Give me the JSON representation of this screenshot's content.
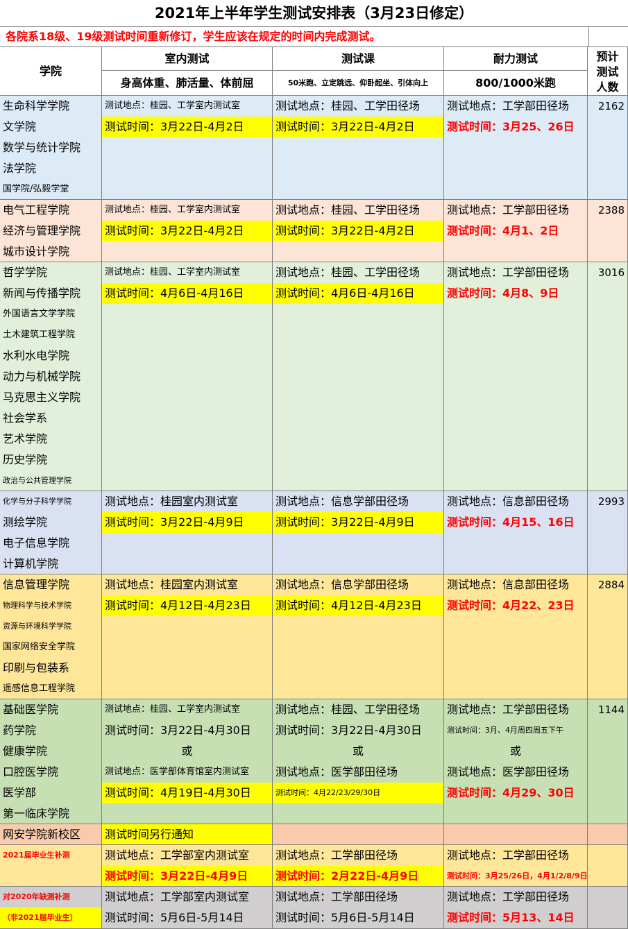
{
  "title": "2021年上半年学生测试安排表（3月23日修定）",
  "notice": "各院系18级、19级测试时间重新修订，学生应该在规定的时间内完成测试。",
  "header": {
    "college": "学院",
    "indoor": "室内测试",
    "indoor_sub": "身高体重、肺活量、体前屈",
    "course": "测试课",
    "course_sub": "50米跑、立定跳远、仰卧起坐、引体向上",
    "endurance": "耐力测试",
    "endurance_sub": "800/1000米跑",
    "count_lines": [
      "预计",
      "测试",
      "人数"
    ]
  },
  "colors": {
    "blue": "#ddebf7",
    "peach": "#fce4d6",
    "green": "#e2efda",
    "lavender": "#d9e1f2",
    "orange": "#ffe699",
    "sage": "#c6e0b4",
    "salmon": "#f8cbad",
    "gray": "#d0cece",
    "highlight": "#ffff00",
    "red": "#ff0000"
  },
  "groups": [
    {
      "color": "#ddebf7",
      "colleges": [
        "生命科学学院",
        "文学院",
        "数学与统计学院",
        "法学院",
        "国学院/弘毅学堂"
      ],
      "indoor": [
        "测试地点：桂园、工学室内测试室",
        "测试时间：3月22日-4月2日"
      ],
      "course": [
        "测试地点：桂园、工学田径场",
        "测试时间：3月22日-4月2日"
      ],
      "endurance": [
        "测试地点：工学部田径场",
        "测试时间：3月25、26日"
      ],
      "count": "2162"
    },
    {
      "color": "#fce4d6",
      "colleges": [
        "电气工程学院",
        "经济与管理学院",
        "城市设计学院"
      ],
      "indoor": [
        "测试地点：桂园、工学室内测试室",
        "测试时间：3月22日-4月2日"
      ],
      "course": [
        "测试地点：桂园、工学田径场",
        "测试时间：3月22日-4月2日"
      ],
      "endurance": [
        "测试地点：工学部田径场",
        "测试时间：4月1、2日"
      ],
      "count": "2388"
    },
    {
      "color": "#e2efda",
      "colleges": [
        "哲学学院",
        "新闻与传播学院",
        "外国语言文学学院",
        "土木建筑工程学院",
        "水利水电学院",
        "动力与机械学院",
        "马克思主义学院",
        "社会学系",
        "艺术学院",
        "历史学院",
        "政治与公共管理学院"
      ],
      "indoor": [
        "测试地点：桂园、工学室内测试室",
        "测试时间：4月6日-4月16日"
      ],
      "course": [
        "测试地点：桂园、工学田径场",
        "测试时间：4月6日-4月16日"
      ],
      "endurance": [
        "测试地点：工学部田径场",
        "测试时间：4月8、9日"
      ],
      "count": "3016"
    },
    {
      "color": "#d9e1f2",
      "colleges": [
        "化学与分子科学学院",
        "测绘学院",
        "电子信息学院",
        "计算机学院"
      ],
      "indoor": [
        "测试地点：桂园室内测试室",
        "测试时间：3月22日-4月9日"
      ],
      "course": [
        "测试地点：信息学部田径场",
        "测试时间：3月22日-4月9日"
      ],
      "endurance": [
        "测试地点：信息部田径场",
        "测试时间：4月15、16日"
      ],
      "count": "2993"
    },
    {
      "color": "#ffe699",
      "colleges": [
        "信息管理学院",
        "物理科学与技术学院",
        "资源与环境科学学院",
        "国家网络安全学院",
        "印刷与包装系",
        "遥感信息工程学院"
      ],
      "indoor": [
        "测试地点：桂园室内测试室",
        "测试时间：4月12日-4月23日"
      ],
      "course": [
        "测试地点：信息学部田径场",
        "测试时间：4月12日-4月23日"
      ],
      "endurance": [
        "测试地点：信息部田径场",
        "测试时间：4月22、23日"
      ],
      "count": "2884"
    },
    {
      "color": "#c6e0b4",
      "colleges": [
        "基础医学院",
        "药学院",
        "健康学院",
        "口腔医学院",
        "医学部",
        "第一临床学院"
      ],
      "indoor": [
        "测试地点：桂园、工学室内测试室",
        "测试时间：3月22日-4月30日",
        "或",
        "测试地点：医学部体育馆室内测试室",
        "测试时间：4月19日-4月30日"
      ],
      "course": [
        "测试地点：桂园、工学田径场",
        "测试时间：3月22日-4月30日",
        "或",
        "测试地点：医学部田径场",
        "测试时间：4月22/23/29/30日"
      ],
      "endurance": [
        "测试地点：工学部田径场",
        "测试时间：3月、4月周四周五下午",
        "或",
        "测试地点：医学部田径场",
        "测试时间：4月29、30日"
      ],
      "count": "1144"
    },
    {
      "color": "#f8cbad",
      "colleges": [
        "网安学院新校区"
      ],
      "indoor": [
        "测试时间另行通知"
      ],
      "course": [],
      "endurance": [],
      "count": ""
    },
    {
      "color": "#ffe699",
      "colleges": [
        "2021届毕业生补测"
      ],
      "indoor": [
        "测试地点：工学部室内测试室",
        "测试时间：3月22日-4月9日"
      ],
      "course": [
        "测试地点：工学部田径场",
        "测试时间：2月22日-4月9日"
      ],
      "endurance": [
        "测试地点：工学部田径场",
        "测试时间：3月25/26日，4月1/2/8/9日"
      ],
      "count": ""
    },
    {
      "color": "#d0cece",
      "colleges": [
        "对2020年缺测补测",
        "（非2021届毕业生）"
      ],
      "indoor": [
        "测试地点：工学部室内测试室",
        "测试时间：5月6日-5月14日"
      ],
      "course": [
        "测试地点：工学部田径场",
        "测试时间：5月6日-5月14日"
      ],
      "endurance": [
        "测试地点：工学部田径场",
        "测试时间：5月13、14日"
      ],
      "count": ""
    }
  ]
}
